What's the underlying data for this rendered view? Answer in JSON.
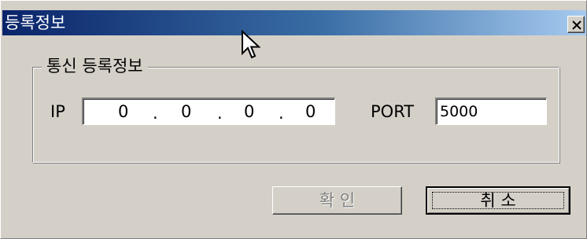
{
  "window": {
    "title": "등록정보",
    "close_glyph": "×"
  },
  "group": {
    "legend": "통신 등록정보"
  },
  "ip": {
    "label": "IP",
    "octets": [
      "0",
      "0",
      "0",
      "0"
    ],
    "separator": "."
  },
  "port": {
    "label": "PORT",
    "value": "5000"
  },
  "buttons": {
    "ok_label": "확 인",
    "ok_enabled": false,
    "cancel_label": "취 소"
  },
  "colors": {
    "title_gradient_start": "#0a246a",
    "title_gradient_end": "#a6caf0",
    "face": "#d4d0c8",
    "disabled_text": "#808080"
  },
  "icons": {
    "close": "close-icon",
    "cursor": "mouse-pointer-icon"
  }
}
